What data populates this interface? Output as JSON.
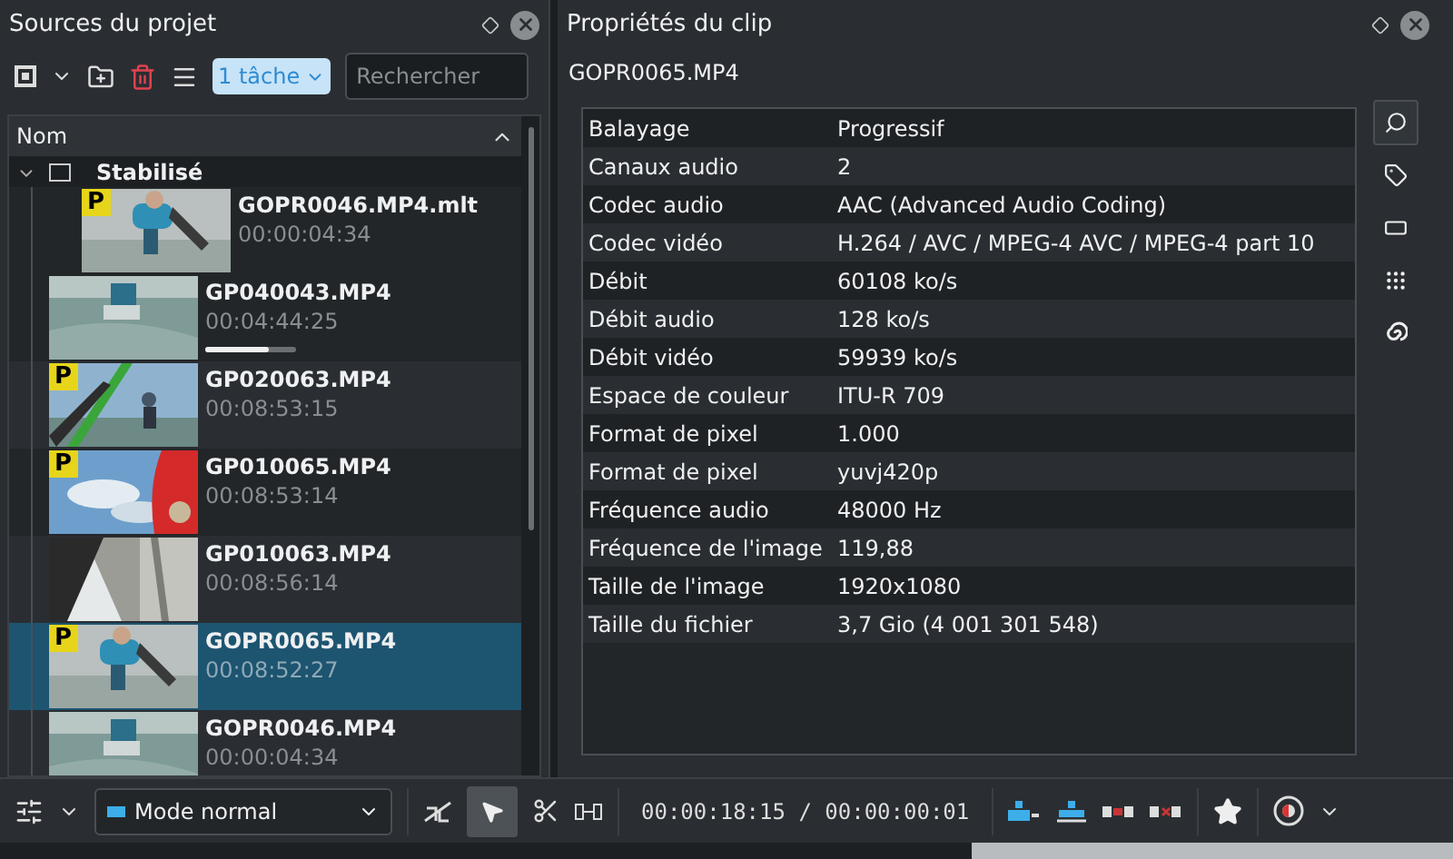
{
  "project_panel": {
    "title": "Sources du projet",
    "task_button": "1 tâche",
    "search": {
      "placeholder": "Rechercher"
    },
    "column": "Nom",
    "folder": {
      "name": "Stabilisé",
      "expanded": true,
      "children": [
        {
          "name": "GOPR0046.MP4.mlt",
          "duration": "00:00:04:34",
          "badge": "P",
          "selected": false
        }
      ]
    },
    "clips": [
      {
        "name": "GP040043.MP4",
        "duration": "00:04:44:25",
        "selected": false,
        "level": 0.7
      },
      {
        "name": "GP020063.MP4",
        "duration": "00:08:53:15",
        "badge": "P",
        "selected": false
      },
      {
        "name": "GP010065.MP4",
        "duration": "00:08:53:14",
        "badge": "P",
        "selected": false
      },
      {
        "name": "GP010063.MP4",
        "duration": "00:08:56:14",
        "selected": false
      },
      {
        "name": "GOPR0065.MP4",
        "duration": "00:08:52:27",
        "badge": "P",
        "selected": true
      },
      {
        "name": "GOPR0046.MP4",
        "duration": "00:00:04:34",
        "selected": false
      }
    ]
  },
  "properties_panel": {
    "title": "Propriétés du clip",
    "clip_name": "GOPR0065.MP4",
    "rows": [
      {
        "name": "Balayage",
        "value": "Progressif"
      },
      {
        "name": "Canaux audio",
        "value": "2"
      },
      {
        "name": "Codec audio",
        "value": "AAC (Advanced Audio Coding)"
      },
      {
        "name": "Codec vidéo",
        "value": "H.264 / AVC / MPEG-4 AVC / MPEG-4 part 10"
      },
      {
        "name": "Débit",
        "value": "60108 ko/s"
      },
      {
        "name": "Débit audio",
        "value": "128 ko/s"
      },
      {
        "name": "Débit vidéo",
        "value": "59939 ko/s"
      },
      {
        "name": "Espace de couleur",
        "value": "ITU-R 709"
      },
      {
        "name": "Format de pixel",
        "value": "1.000"
      },
      {
        "name": "Format de pixel",
        "value": "yuvj420p"
      },
      {
        "name": "Fréquence audio",
        "value": "48000 Hz"
      },
      {
        "name": "Fréquence de l'image",
        "value": "119,88"
      },
      {
        "name": "Taille de l'image",
        "value": "1920x1080"
      },
      {
        "name": "Taille du fichier",
        "value": "3,7 Gio (4 001 301 548)"
      }
    ]
  },
  "toolbar": {
    "mode": "Mode normal",
    "timecode": "00:00:18:15 / 00:00:00:01"
  }
}
